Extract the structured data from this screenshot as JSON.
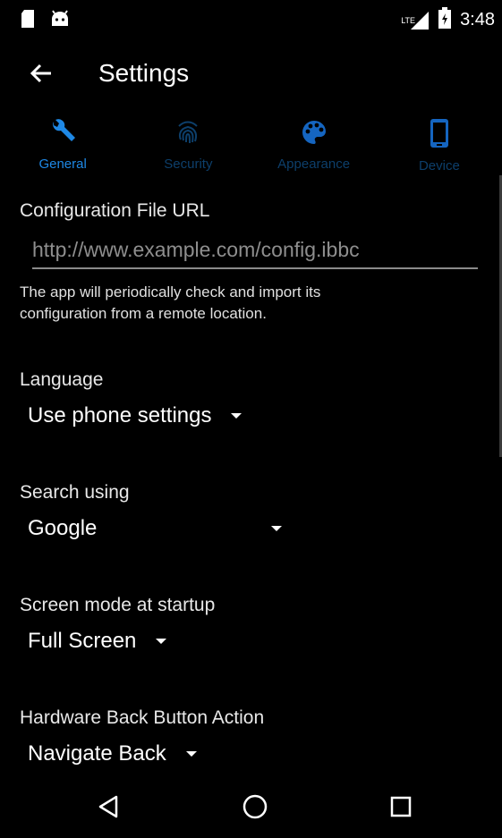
{
  "status_bar": {
    "time": "3:48",
    "network": "LTE",
    "icons": [
      "sd-card-icon",
      "android-icon",
      "signal-icon",
      "battery-icon"
    ]
  },
  "toolbar": {
    "title": "Settings",
    "back_icon": "arrow-left-icon"
  },
  "tabs": [
    {
      "label": "General",
      "icon": "wrench-icon",
      "active": true
    },
    {
      "label": "Security",
      "icon": "fingerprint-icon",
      "active": false
    },
    {
      "label": "Appearance",
      "icon": "palette-icon",
      "active": false
    },
    {
      "label": "Device",
      "icon": "phone-icon",
      "active": false
    }
  ],
  "settings": {
    "config_url": {
      "label": "Configuration File URL",
      "placeholder": "http://www.example.com/config.ibbc",
      "value": "",
      "help": "The app will periodically check and import its configuration from a remote location."
    },
    "language": {
      "label": "Language",
      "value": "Use phone settings"
    },
    "search": {
      "label": "Search using",
      "value": "Google"
    },
    "screen_mode": {
      "label": "Screen mode at startup",
      "value": "Full Screen"
    },
    "back_action": {
      "label": "Hardware Back Button Action",
      "value": "Navigate Back"
    }
  },
  "nav_bar": {
    "icons": [
      "back-triangle-icon",
      "home-circle-icon",
      "recents-square-icon"
    ]
  },
  "colors": {
    "accent": "#1e88e5",
    "inactive_tab": "#0d3f6b",
    "background": "#000000"
  }
}
